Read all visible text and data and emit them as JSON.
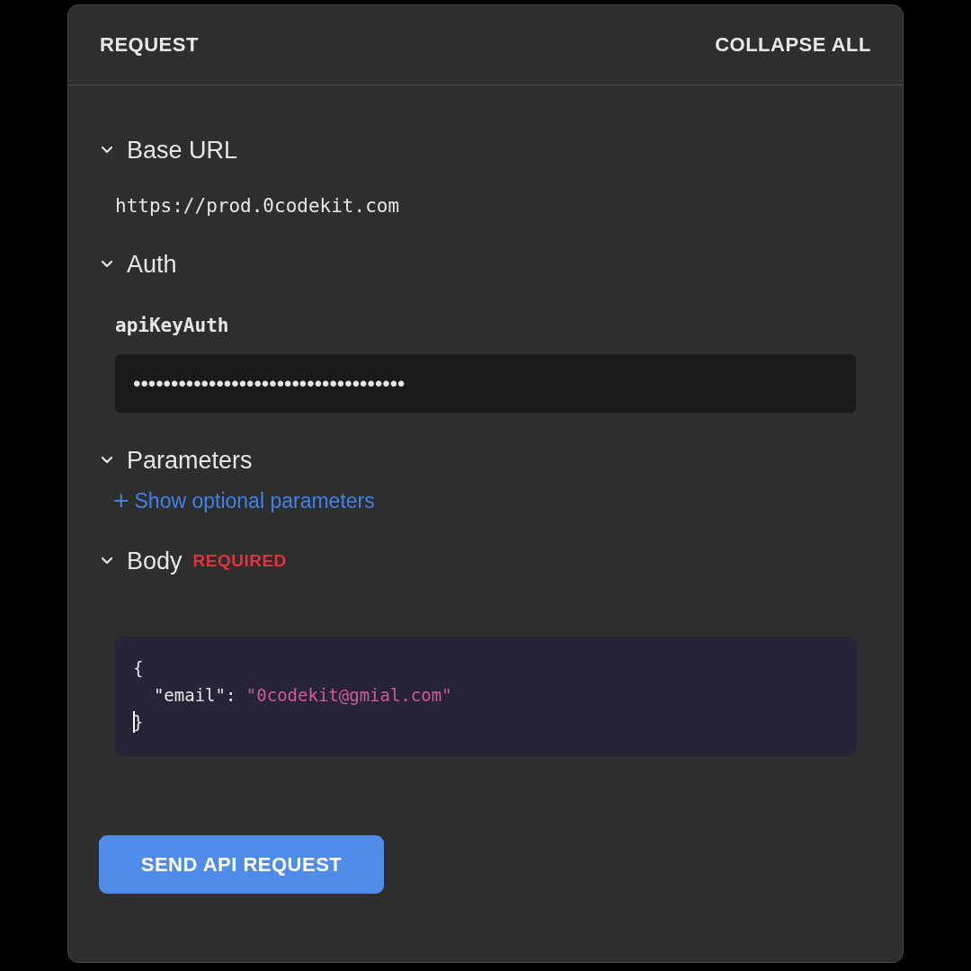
{
  "panel": {
    "title": "REQUEST",
    "action": "COLLAPSE ALL"
  },
  "sections": [
    {
      "kind": "text",
      "title": "Base URL",
      "expanded": true,
      "value": "https://prod.0codekit.com"
    },
    {
      "kind": "key",
      "title": "Auth",
      "expanded": true,
      "label": "apiKeyAuth",
      "value": "••••••••••••••••••••••••••••••••••••"
    },
    {
      "kind": "link",
      "title": "Parameters",
      "expanded": true,
      "icon": "+",
      "link": "Show optional parameters"
    },
    {
      "kind": "code",
      "title": "Body",
      "expanded": true,
      "badge": "REQUIRED",
      "lines": [
        {
          "cursor": false,
          "tokens": [
            {
              "kind": "punct",
              "text": "{"
            }
          ]
        },
        {
          "cursor": false,
          "tokens": [
            {
              "kind": "key",
              "text": "  \"email\": "
            },
            {
              "kind": "string",
              "text": "\"0codekit@gmial.com\""
            }
          ]
        },
        {
          "cursor": true,
          "tokens": [
            {
              "kind": "punct",
              "text": "}"
            }
          ]
        }
      ]
    }
  ],
  "button": "SEND API REQUEST"
}
